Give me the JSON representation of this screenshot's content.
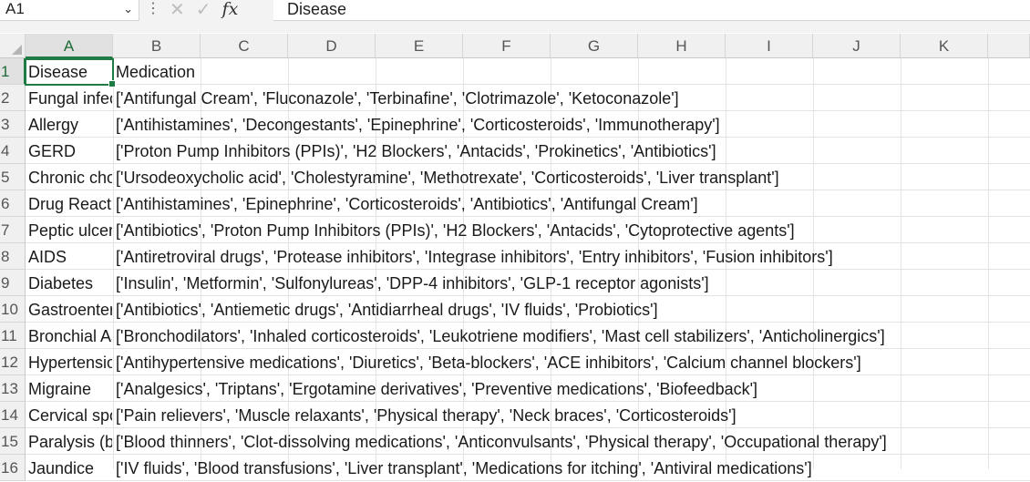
{
  "formula_bar": {
    "name_box": "A1",
    "name_box_icon": "chevron-down-icon",
    "cancel_icon": "x-icon",
    "enter_icon": "check-icon",
    "fx_label": "fx",
    "formula_value": "Disease"
  },
  "columns": [
    "A",
    "B",
    "C",
    "D",
    "E",
    "F",
    "G",
    "H",
    "I",
    "J",
    "K"
  ],
  "selected_cell": "A1",
  "rows": [
    {
      "num": "1",
      "a": "Disease",
      "b": "Medication"
    },
    {
      "num": "2",
      "a": "Fungal infection",
      "b": "['Antifungal Cream', 'Fluconazole', 'Terbinafine', 'Clotrimazole', 'Ketoconazole']"
    },
    {
      "num": "3",
      "a": "Allergy",
      "b": "['Antihistamines', 'Decongestants', 'Epinephrine', 'Corticosteroids', 'Immunotherapy']"
    },
    {
      "num": "4",
      "a": "GERD",
      "b": "['Proton Pump Inhibitors (PPIs)', 'H2 Blockers', 'Antacids', 'Prokinetics', 'Antibiotics']"
    },
    {
      "num": "5",
      "a": "Chronic cholestasis",
      "b": "['Ursodeoxycholic acid', 'Cholestyramine', 'Methotrexate', 'Corticosteroids', 'Liver transplant']"
    },
    {
      "num": "6",
      "a": "Drug Reaction",
      "b": "['Antihistamines', 'Epinephrine', 'Corticosteroids', 'Antibiotics', 'Antifungal Cream']"
    },
    {
      "num": "7",
      "a": "Peptic ulcer disease",
      "b": "['Antibiotics', 'Proton Pump Inhibitors (PPIs)', 'H2 Blockers', 'Antacids', 'Cytoprotective agents']"
    },
    {
      "num": "8",
      "a": "AIDS",
      "b": "['Antiretroviral drugs', 'Protease inhibitors', 'Integrase inhibitors', 'Entry inhibitors', 'Fusion inhibitors']"
    },
    {
      "num": "9",
      "a": "Diabetes",
      "b": "['Insulin', 'Metformin', 'Sulfonylureas', 'DPP-4 inhibitors', 'GLP-1 receptor agonists']"
    },
    {
      "num": "10",
      "a": "Gastroenteritis",
      "b": "['Antibiotics', 'Antiemetic drugs', 'Antidiarrheal drugs', 'IV fluids', 'Probiotics']"
    },
    {
      "num": "11",
      "a": "Bronchial Asthma",
      "b": "['Bronchodilators', 'Inhaled corticosteroids', 'Leukotriene modifiers', 'Mast cell stabilizers', 'Anticholinergics']"
    },
    {
      "num": "12",
      "a": "Hypertension",
      "b": "['Antihypertensive medications', 'Diuretics', 'Beta-blockers', 'ACE inhibitors', 'Calcium channel blockers']"
    },
    {
      "num": "13",
      "a": "Migraine",
      "b": "['Analgesics', 'Triptans', 'Ergotamine derivatives', 'Preventive medications', 'Biofeedback']"
    },
    {
      "num": "14",
      "a": "Cervical spondylosis",
      "b": "['Pain relievers', 'Muscle relaxants', 'Physical therapy', 'Neck braces', 'Corticosteroids']"
    },
    {
      "num": "15",
      "a": "Paralysis (brain hemorrhage)",
      "b": "['Blood thinners', 'Clot-dissolving medications', 'Anticonvulsants', 'Physical therapy', 'Occupational therapy']"
    },
    {
      "num": "16",
      "a": "Jaundice",
      "b": "['IV fluids', 'Blood transfusions', 'Liver transplant', 'Medications for itching', 'Antiviral medications']"
    }
  ]
}
